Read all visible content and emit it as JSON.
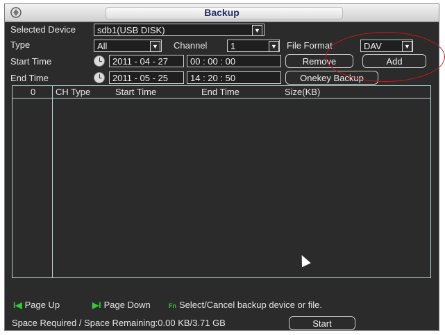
{
  "window": {
    "title": "Backup"
  },
  "selected_device": {
    "label": "Selected Device",
    "value": "sdb1(USB DISK)"
  },
  "type": {
    "label": "Type",
    "value": "All"
  },
  "channel": {
    "label": "Channel",
    "value": "1"
  },
  "file_format": {
    "label": "File Format",
    "value": "DAV"
  },
  "start_time": {
    "label": "Start Time",
    "date": "2011 - 04 - 27",
    "time": "00 : 00 : 00"
  },
  "end_time": {
    "label": "End Time",
    "date": "2011 - 05 - 25",
    "time": "14 : 20 : 50"
  },
  "buttons": {
    "remove": "Remove",
    "add": "Add",
    "onekey": "Onekey Backup",
    "start": "Start"
  },
  "table": {
    "columns": [
      "0",
      "CH",
      "Type",
      "Start Time",
      "End Time",
      "Size(KB)"
    ]
  },
  "hints": {
    "page_up": "Page Up",
    "page_down": "Page Down",
    "select": "Select/Cancel backup device or file."
  },
  "space": {
    "text": "Space Required / Space Remaining:0.00 KB/3.71 GB"
  },
  "colors": {
    "annotation": "#d01818",
    "hint_key": "#38c838",
    "table_border": "#b7d5d5"
  }
}
